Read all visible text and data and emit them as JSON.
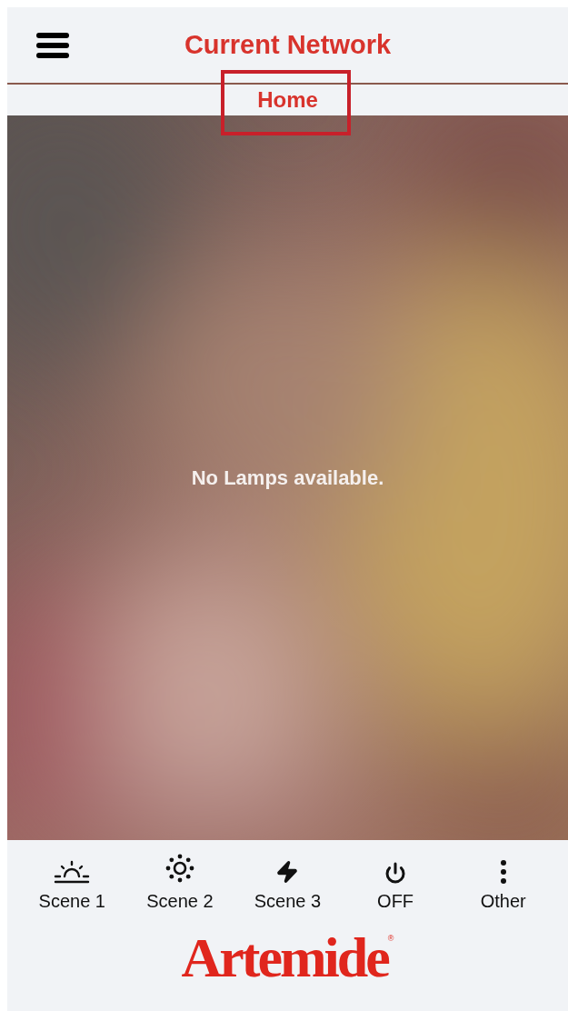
{
  "header": {
    "title": "Current Network",
    "network": "Home"
  },
  "content": {
    "message": "No Lamps available."
  },
  "toolbar": [
    {
      "label": "Scene 1"
    },
    {
      "label": "Scene 2"
    },
    {
      "label": "Scene 3"
    },
    {
      "label": "OFF"
    },
    {
      "label": "Other"
    }
  ],
  "logo": {
    "text": "Artemide",
    "mark": "®"
  }
}
